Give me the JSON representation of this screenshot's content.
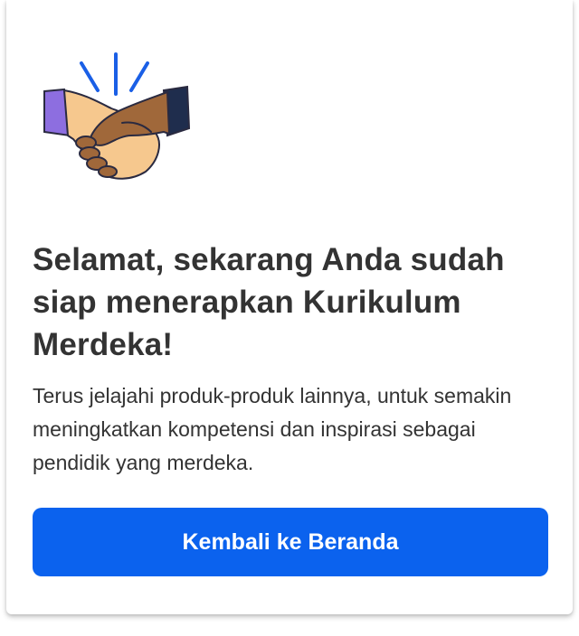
{
  "dialog": {
    "illustration_icon": "handshake-icon",
    "title": "Selamat, sekarang Anda sudah siap menerapkan Kurikulum Merdeka!",
    "description": "Terus jelajahi produk-produk lainnya, untuk semakin meningkatkan kompetensi dan inspirasi sebagai pendidik yang merdeka.",
    "button_label": "Kembali ke Beranda"
  },
  "colors": {
    "accent": "#0b62ee",
    "text": "#333333",
    "spark": "#1a5fe6",
    "skin_light": "#f6c88e",
    "skin_dark": "#a0683a",
    "sleeve_purple": "#8d6ee0",
    "sleeve_navy": "#1f2d4d"
  }
}
